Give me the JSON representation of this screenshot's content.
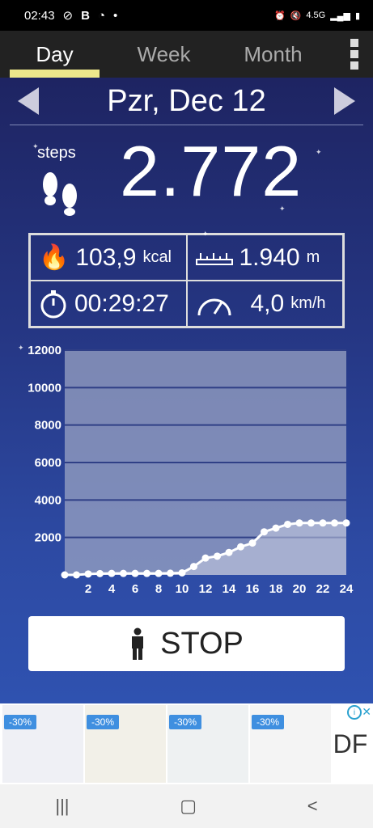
{
  "status": {
    "time": "02:43",
    "b": "B",
    "dot": "•",
    "network": "4.5G"
  },
  "tabs": [
    {
      "label": "Day",
      "active": true
    },
    {
      "label": "Week",
      "active": false
    },
    {
      "label": "Month",
      "active": false
    }
  ],
  "date": "Pzr, Dec 12",
  "steps_label": "steps",
  "steps": "2.772",
  "stats": {
    "kcal_value": "103,9",
    "kcal_unit": "kcal",
    "distance_value": "1.940",
    "distance_unit": "m",
    "time_value": "00:29:27",
    "speed_value": "4,0",
    "speed_unit": "km/h"
  },
  "stop_label": "STOP",
  "ad": {
    "discount": "-30%",
    "brand": "DF"
  },
  "colors": {
    "accent": "#ede78b",
    "chart_fill": "#9aa3c3",
    "line": "#ffffff"
  },
  "chart_data": {
    "type": "area",
    "x": [
      0,
      1,
      2,
      3,
      4,
      5,
      6,
      7,
      8,
      9,
      10,
      11,
      12,
      13,
      14,
      15,
      16,
      17,
      18,
      19,
      20,
      21,
      22,
      23,
      24
    ],
    "values": [
      0,
      0,
      50,
      70,
      80,
      80,
      80,
      80,
      80,
      90,
      110,
      450,
      900,
      1000,
      1200,
      1500,
      1700,
      2300,
      2500,
      2700,
      2772,
      2772,
      2772,
      2772,
      2772
    ],
    "xticks": [
      "2",
      "4",
      "6",
      "8",
      "10",
      "12",
      "14",
      "16",
      "18",
      "20",
      "22",
      "24"
    ],
    "yticks": [
      "2000",
      "4000",
      "6000",
      "8000",
      "10000",
      "12000"
    ],
    "ylim": [
      0,
      12000
    ],
    "xlim": [
      0,
      24
    ],
    "grid": true
  }
}
